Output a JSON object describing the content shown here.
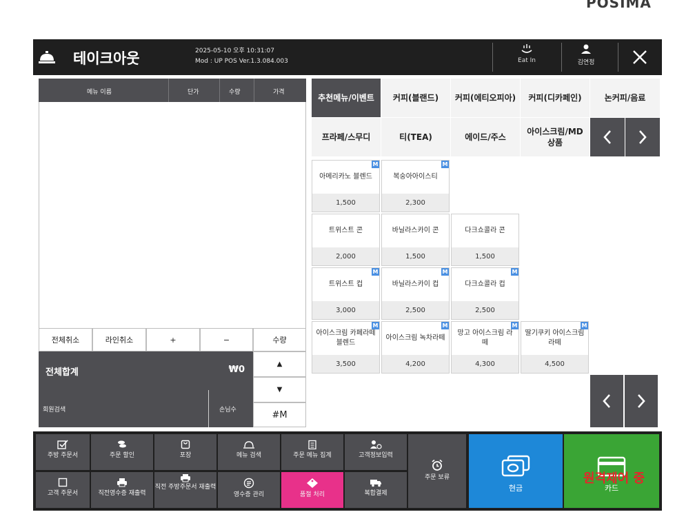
{
  "brand": "POSIMA",
  "header": {
    "title": "테이크아웃",
    "datetime": "2025-05-10 오후 10:31:07",
    "version": "Mod : UP POS Ver.1.3.084.003",
    "eat_in": "Eat In",
    "user": "김연정"
  },
  "order": {
    "columns": [
      "메뉴 이름",
      "단가",
      "수량",
      "가격"
    ],
    "controls": [
      "전체취소",
      "라인취소",
      "+",
      "−",
      "수량"
    ],
    "total_label": "전체합계",
    "total_amount": "₩0",
    "up": "▲",
    "down": "▼",
    "member_search": "회원검색",
    "guests": "손님수",
    "hash_m": "#M"
  },
  "categories": [
    {
      "label": "추천메뉴/이벤트",
      "active": true
    },
    {
      "label": "커피(블랜드)",
      "active": false
    },
    {
      "label": "커피(에티오피아)",
      "active": false
    },
    {
      "label": "커피(디카페인)",
      "active": false
    },
    {
      "label": "논커피/음료",
      "active": false
    },
    {
      "label": "프라페/스무디",
      "active": false
    },
    {
      "label": "티(TEA)",
      "active": false
    },
    {
      "label": "에이드/주스",
      "active": false
    },
    {
      "label": "아이스크림/MD 상품",
      "active": false
    }
  ],
  "items": [
    {
      "name": "아메리카노 블렌드",
      "price": "1,500",
      "m": true
    },
    {
      "name": "복숭아아이스티",
      "price": "2,300",
      "m": true
    },
    {
      "name": "트위스트 콘",
      "price": "2,000",
      "m": false
    },
    {
      "name": "바닐라스카이 콘",
      "price": "1,500",
      "m": false
    },
    {
      "name": "다크쇼콜라 콘",
      "price": "1,500",
      "m": false
    },
    {
      "name": "트위스트 컵",
      "price": "3,000",
      "m": true
    },
    {
      "name": "바닐라스카이 컵",
      "price": "2,500",
      "m": true
    },
    {
      "name": "다크쇼콜라 컵",
      "price": "2,500",
      "m": true
    },
    {
      "name": "아이스크림 카페라떼 블렌드",
      "price": "3,500",
      "m": true
    },
    {
      "name": "아이스크림 녹차라떼",
      "price": "4,200",
      "m": true
    },
    {
      "name": "망고 아이스크림 라떼",
      "price": "4,300",
      "m": true
    },
    {
      "name": "딸기쿠키 아이스크림 라떼",
      "price": "4,500",
      "m": true
    }
  ],
  "badge_text": "M",
  "functions": {
    "kitchen_order": "주방 주문서",
    "order_discount": "주문 할인",
    "takeout": "포장",
    "menu_search": "메뉴 검색",
    "order_menu_total": "주문 메뉴 집계",
    "customer_info": "고객정보입력",
    "customer_order": "고객 주문서",
    "reprint_receipt": "직전영수증 재출력",
    "reprint_kitchen": "직전 주방주문서 재출력",
    "receipt_manage": "영수증 관리",
    "soldout": "품절 처리",
    "split_pay": "복합결제",
    "hold_order": "주문 보류",
    "cash": "현금",
    "card": "카드"
  },
  "remote_label": "원격제어 중",
  "colors": {
    "dark": "#1f1f1f",
    "panel": "#4e4e52",
    "cash": "#1e88d8",
    "card": "#3aa535",
    "pink": "#e8318a",
    "badge": "#4a90e2"
  }
}
